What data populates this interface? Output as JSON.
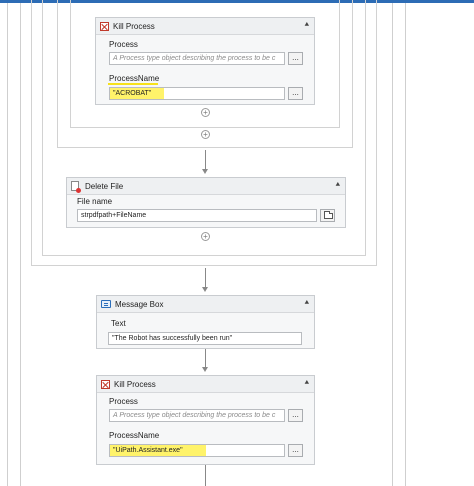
{
  "kill_process_1": {
    "title": "Kill Process",
    "process_label": "Process",
    "process_placeholder": "A Process type object describing the process to be c",
    "process_name_label": "ProcessName",
    "process_name_value": "\"ACROBAT\"",
    "browse_label": "..."
  },
  "delete_file": {
    "title": "Delete File",
    "file_name_label": "File name",
    "file_name_value": "strpdfpath+FileName"
  },
  "message_box": {
    "title": "Message Box",
    "text_label": "Text",
    "text_value": "\"The Robot has successfully been run\""
  },
  "kill_process_2": {
    "title": "Kill Process",
    "process_label": "Process",
    "process_placeholder": "A Process type object describing the process to be c",
    "process_name_label": "ProcessName",
    "process_name_value": "\"UiPath.Assistant.exe\"",
    "browse_label": "..."
  },
  "icons": {
    "collapse": "double-chevron-up-icon",
    "add": "plus-circle-icon"
  },
  "colors": {
    "highlight": "#fff36a",
    "kill_icon": "#c0392b",
    "accent": "#2d6cb5"
  }
}
